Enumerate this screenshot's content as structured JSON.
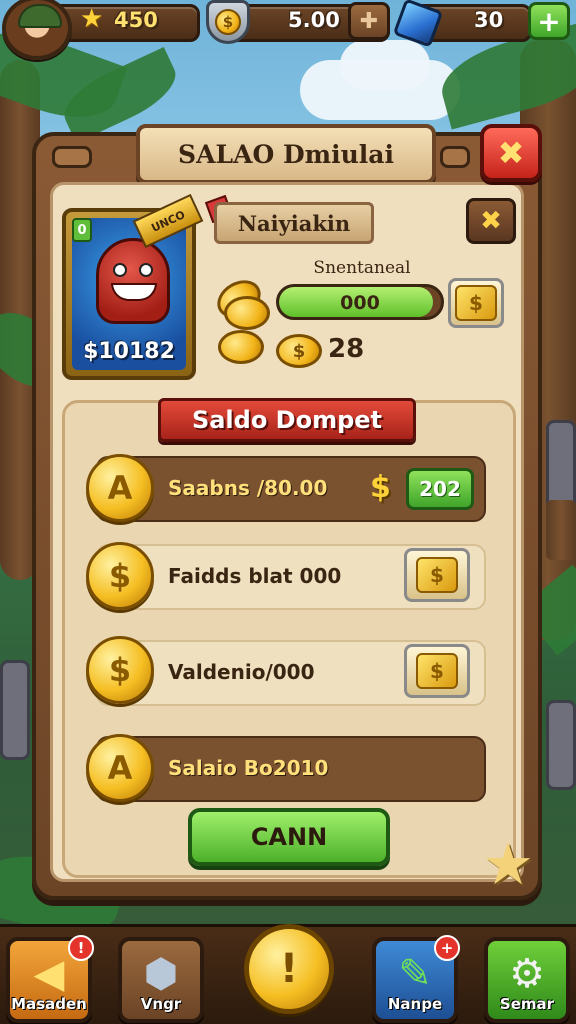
{
  "hud": {
    "stars": "450",
    "coins": "5.00",
    "gems": "30",
    "plus_label": "+",
    "coin_symbol": "$"
  },
  "panel": {
    "title": "SALAO Dmiulai",
    "close_glyph": "✖"
  },
  "character": {
    "level": "0",
    "tag": "UNCO",
    "value": "$10182",
    "name": "Naiyiakin",
    "sub_label": "Snentaneal",
    "progress_text": "000",
    "progress_fraction": 0.95,
    "coin_count": "28",
    "close_glyph": "✖"
  },
  "saldo": {
    "header": "Saldo Dompet",
    "rows": [
      {
        "label": "Saabns /80.00",
        "style": "dark",
        "coin_glyph": "A",
        "value": "202",
        "has_dollar": true
      },
      {
        "label": "Faidds blat 000",
        "style": "light",
        "coin_glyph": "$",
        "tile_glyph": "$"
      },
      {
        "label": "Valdenio/000",
        "style": "light",
        "coin_glyph": "$",
        "tile_glyph": "$"
      },
      {
        "label": "Salaio Bo2010",
        "style": "dark",
        "coin_glyph": "A"
      }
    ],
    "cta": "CANN"
  },
  "nav": {
    "items": [
      {
        "label": "Masaden",
        "badge": "!"
      },
      {
        "label": "Vngr"
      },
      {
        "label": "Nanpe",
        "badge": "+"
      },
      {
        "label": "Semar"
      }
    ],
    "center_glyph": "!"
  },
  "colors": {
    "accent_green": "#5fbf2a",
    "accent_red": "#c5231a",
    "wood": "#6b4426",
    "parchment": "#f0dfbe",
    "gold": "#f5be22"
  }
}
